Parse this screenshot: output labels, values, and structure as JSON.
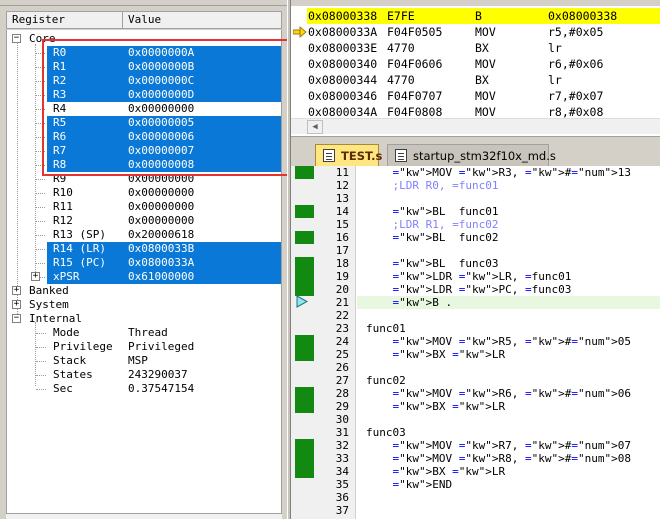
{
  "registers_panel": {
    "header": {
      "col_register": "Register",
      "col_value": "Value"
    },
    "core_label": "Core",
    "core_registers": [
      {
        "name": "R0",
        "value": "0x0000000A",
        "selected": true
      },
      {
        "name": "R1",
        "value": "0x0000000B",
        "selected": true
      },
      {
        "name": "R2",
        "value": "0x0000000C",
        "selected": true
      },
      {
        "name": "R3",
        "value": "0x0000000D",
        "selected": true
      },
      {
        "name": "R4",
        "value": "0x00000000",
        "selected": false
      },
      {
        "name": "R5",
        "value": "0x00000005",
        "selected": true
      },
      {
        "name": "R6",
        "value": "0x00000006",
        "selected": true
      },
      {
        "name": "R7",
        "value": "0x00000007",
        "selected": true
      },
      {
        "name": "R8",
        "value": "0x00000008",
        "selected": true
      },
      {
        "name": "R9",
        "value": "0x00000000",
        "selected": false
      },
      {
        "name": "R10",
        "value": "0x00000000",
        "selected": false
      },
      {
        "name": "R11",
        "value": "0x00000000",
        "selected": false
      },
      {
        "name": "R12",
        "value": "0x00000000",
        "selected": false
      },
      {
        "name": "R13 (SP)",
        "value": "0x20000618",
        "selected": false
      },
      {
        "name": "R14 (LR)",
        "value": "0x0800033B",
        "selected": true
      },
      {
        "name": "R15 (PC)",
        "value": "0x0800033A",
        "selected": true
      },
      {
        "name": "xPSR",
        "value": "0x61000000",
        "selected": true
      }
    ],
    "groups": [
      "Banked",
      "System",
      "Internal"
    ],
    "internal": [
      {
        "name": "Mode",
        "value": "Thread"
      },
      {
        "name": "Privilege",
        "value": "Privileged"
      },
      {
        "name": "Stack",
        "value": "MSP"
      },
      {
        "name": "States",
        "value": "243290037"
      },
      {
        "name": "Sec",
        "value": "0.37547154"
      }
    ]
  },
  "disassembly": {
    "rows": [
      {
        "addr": "0x08000338",
        "opcode": "E7FE",
        "mnemonic": "B",
        "operands": "0x08000338",
        "current": true
      },
      {
        "addr": "0x0800033A",
        "opcode": "F04F0505",
        "mnemonic": "MOV",
        "operands": "r5,#0x05",
        "current": false
      },
      {
        "addr": "0x0800033E",
        "opcode": "4770",
        "mnemonic": "BX",
        "operands": "lr",
        "current": false
      },
      {
        "addr": "0x08000340",
        "opcode": "F04F0606",
        "mnemonic": "MOV",
        "operands": "r6,#0x06",
        "current": false
      },
      {
        "addr": "0x08000344",
        "opcode": "4770",
        "mnemonic": "BX",
        "operands": "lr",
        "current": false
      },
      {
        "addr": "0x08000346",
        "opcode": "F04F0707",
        "mnemonic": "MOV",
        "operands": "r7,#0x07",
        "current": false
      },
      {
        "addr": "0x0800034A",
        "opcode": "F04F0808",
        "mnemonic": "MOV",
        "operands": "r8,#0x08",
        "current": false
      }
    ]
  },
  "tabs": [
    {
      "label": "TEST.s",
      "active": true
    },
    {
      "label": "startup_stm32f10x_md.s",
      "active": false
    }
  ],
  "editor": {
    "lines": [
      {
        "num": "11",
        "marker": true,
        "text": "    MOV R3, #13"
      },
      {
        "num": "12",
        "marker": false,
        "text": "    ;LDR R0, =func01"
      },
      {
        "num": "13",
        "marker": false,
        "text": ""
      },
      {
        "num": "14",
        "marker": true,
        "text": "    BL  func01"
      },
      {
        "num": "15",
        "marker": false,
        "text": "    ;LDR R1, =func02"
      },
      {
        "num": "16",
        "marker": true,
        "text": "    BL  func02"
      },
      {
        "num": "17",
        "marker": false,
        "text": ""
      },
      {
        "num": "18",
        "marker": true,
        "text": "    BL  func03"
      },
      {
        "num": "19",
        "marker": true,
        "text": "    LDR LR, =func01"
      },
      {
        "num": "20",
        "marker": true,
        "text": "    LDR PC, =func03"
      },
      {
        "num": "21",
        "marker": false,
        "text": "    B ."
      },
      {
        "num": "22",
        "marker": false,
        "text": ""
      },
      {
        "num": "23",
        "marker": false,
        "text": "func01"
      },
      {
        "num": "24",
        "marker": true,
        "text": "    MOV R5, #05"
      },
      {
        "num": "25",
        "marker": true,
        "text": "    BX LR"
      },
      {
        "num": "26",
        "marker": false,
        "text": ""
      },
      {
        "num": "27",
        "marker": false,
        "text": "func02"
      },
      {
        "num": "28",
        "marker": true,
        "text": "    MOV R6, #06"
      },
      {
        "num": "29",
        "marker": true,
        "text": "    BX LR"
      },
      {
        "num": "30",
        "marker": false,
        "text": ""
      },
      {
        "num": "31",
        "marker": false,
        "text": "func03"
      },
      {
        "num": "32",
        "marker": true,
        "text": "    MOV R7, #07"
      },
      {
        "num": "33",
        "marker": true,
        "text": "    MOV R8, #08"
      },
      {
        "num": "34",
        "marker": true,
        "text": "    BX LR"
      },
      {
        "num": "35",
        "marker": false,
        "text": "    END"
      },
      {
        "num": "36",
        "marker": false,
        "text": ""
      },
      {
        "num": "37",
        "marker": false,
        "text": ""
      }
    ]
  },
  "colors": {
    "selection": "#0a78d7",
    "highlight_box": "#e53333",
    "current_instruction": "#ffff00",
    "code_marker": "#128a12",
    "keyword": "#0000ff",
    "comment": "#8080ff",
    "immediate": "#c00000"
  },
  "icons": {
    "disassembly_pointer": "yellow-arrow-icon",
    "editor_pointer": "cyan-arrow-icon",
    "tab_file": "file-icon"
  }
}
